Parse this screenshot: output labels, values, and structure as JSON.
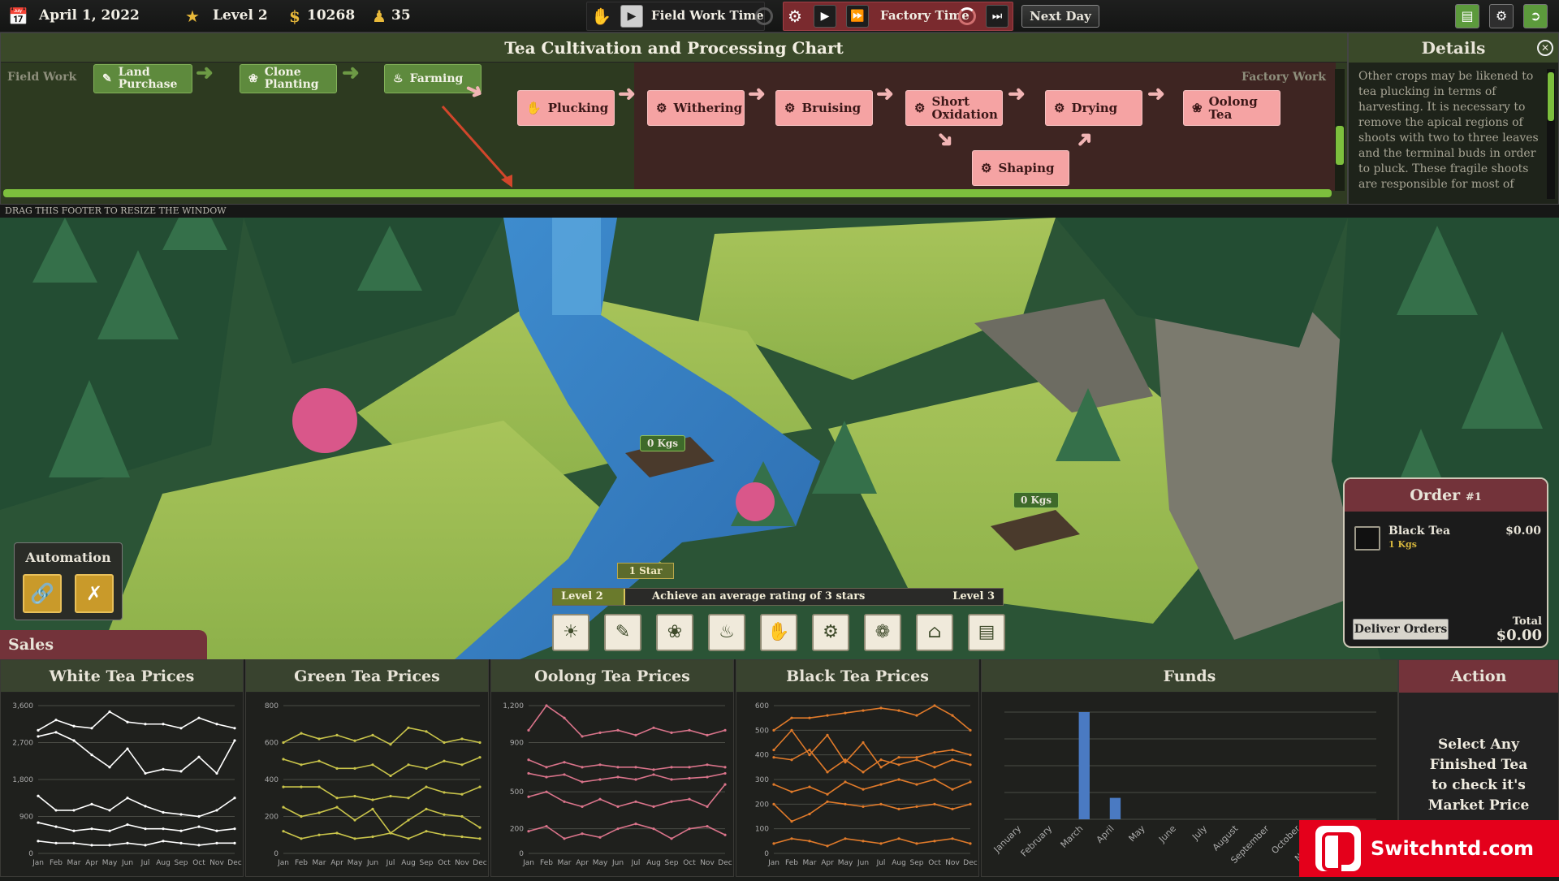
{
  "topbar": {
    "date": "April 1, 2022",
    "level": "Level 2",
    "money": "10268",
    "workers": "35",
    "field_work_time": "Field Work Time",
    "factory_time": "Factory Time",
    "next_day": "Next Day"
  },
  "cultivation_chart": {
    "title": "Tea Cultivation and Processing Chart",
    "field_label": "Field Work",
    "factory_label": "Factory Work",
    "field_nodes": [
      "Land Purchase",
      "Clone Planting",
      "Farming"
    ],
    "factory_nodes": [
      "Plucking",
      "Withering",
      "Bruising",
      "Short Oxidation",
      "Drying",
      "Oolong Tea",
      "Shaping"
    ]
  },
  "details": {
    "title": "Details",
    "text": "Other crops may be likened to tea plucking in terms of harvesting. It is necessary to remove the apical regions of shoots with two to three leaves and the terminal buds in order to pluck. These fragile shoots are responsible for most of"
  },
  "footer_hint": "DRAG THIS FOOTER TO RESIZE THE WINDOW",
  "scene": {
    "plot1_label": "0 Kgs",
    "plot2_label": "0 Kgs"
  },
  "automation": {
    "title": "Automation",
    "icons": [
      "link-icon",
      "unlink-icon"
    ]
  },
  "progress": {
    "star_label": "1 Star",
    "current_level": "Level 2",
    "goal": "Achieve an average rating of 3 stars",
    "next_level": "Level 3",
    "fraction": 0.16
  },
  "toolbar_icons": [
    "weather-icon",
    "pen-icon",
    "plant-icon",
    "watering-can-icon",
    "plucking-icon",
    "gear-icon",
    "leaf-icon",
    "house-icon",
    "chart-icon"
  ],
  "order": {
    "title": "Order",
    "number": "#1",
    "item_name": "Black Tea",
    "item_qty": "1 Kgs",
    "item_price": "$0.00",
    "deliver_label": "Deliver Orders",
    "total_label": "Total",
    "total_value": "$0.00"
  },
  "sales": {
    "tab_label": "Sales",
    "action_title": "Action",
    "action_text": "Select Any Finished Tea to check it's Market Price",
    "funds_title": "Funds"
  },
  "chart_data": [
    {
      "type": "line",
      "title": "White Tea Prices",
      "categories": [
        "Jan",
        "Feb",
        "Mar",
        "Apr",
        "May",
        "Jun",
        "Jul",
        "Aug",
        "Sep",
        "Oct",
        "Nov",
        "Dec"
      ],
      "ylim": [
        0,
        3600
      ],
      "y_ticks": [
        "0",
        "900",
        "1,800",
        "2,700",
        "3,600"
      ],
      "line_color": "#ffffff",
      "series": [
        {
          "values": [
            3000,
            3250,
            3100,
            3050,
            3450,
            3200,
            3150,
            3150,
            3050,
            3300,
            3150,
            3050
          ]
        },
        {
          "values": [
            2850,
            2950,
            2750,
            2400,
            2100,
            2550,
            1950,
            2050,
            2000,
            2350,
            1950,
            2750
          ]
        },
        {
          "values": [
            1400,
            1050,
            1050,
            1200,
            1050,
            1350,
            1150,
            1000,
            950,
            900,
            1050,
            1350
          ]
        },
        {
          "values": [
            750,
            650,
            550,
            600,
            550,
            700,
            600,
            600,
            550,
            650,
            550,
            600
          ]
        },
        {
          "values": [
            300,
            250,
            250,
            200,
            200,
            250,
            200,
            300,
            250,
            200,
            250,
            250
          ]
        }
      ]
    },
    {
      "type": "line",
      "title": "Green Tea Prices",
      "categories": [
        "Jan",
        "Feb",
        "Mar",
        "Apr",
        "May",
        "Jun",
        "Jul",
        "Aug",
        "Sep",
        "Oct",
        "Nov",
        "Dec"
      ],
      "ylim": [
        0,
        800
      ],
      "y_ticks": [
        "0",
        "200",
        "400",
        "600",
        "800"
      ],
      "line_color": "#c9c44a",
      "series": [
        {
          "values": [
            600,
            650,
            620,
            640,
            610,
            640,
            590,
            680,
            660,
            600,
            620,
            600
          ]
        },
        {
          "values": [
            510,
            480,
            500,
            460,
            460,
            480,
            420,
            480,
            460,
            500,
            480,
            520
          ]
        },
        {
          "values": [
            360,
            360,
            360,
            300,
            310,
            290,
            310,
            300,
            360,
            330,
            320,
            360
          ]
        },
        {
          "values": [
            250,
            200,
            220,
            250,
            180,
            240,
            110,
            180,
            240,
            210,
            200,
            140
          ]
        },
        {
          "values": [
            120,
            80,
            100,
            110,
            80,
            90,
            110,
            80,
            120,
            100,
            90,
            80
          ]
        }
      ]
    },
    {
      "type": "line",
      "title": "Oolong Tea Prices",
      "categories": [
        "Jan",
        "Feb",
        "Mar",
        "Apr",
        "May",
        "Jun",
        "Jul",
        "Aug",
        "Sep",
        "Oct",
        "Nov",
        "Dec"
      ],
      "ylim": [
        0,
        1200
      ],
      "y_ticks": [
        "0",
        "200",
        "500",
        "900",
        "1,200"
      ],
      "line_color": "#d9738a",
      "series": [
        {
          "values": [
            1000,
            1200,
            1100,
            950,
            980,
            1000,
            960,
            1020,
            980,
            1000,
            960,
            1000
          ]
        },
        {
          "values": [
            760,
            700,
            740,
            700,
            720,
            700,
            700,
            680,
            700,
            700,
            720,
            700
          ]
        },
        {
          "values": [
            650,
            620,
            640,
            580,
            600,
            620,
            600,
            640,
            600,
            610,
            620,
            650
          ]
        },
        {
          "values": [
            460,
            500,
            420,
            380,
            440,
            380,
            420,
            380,
            420,
            440,
            380,
            560
          ]
        },
        {
          "values": [
            180,
            220,
            120,
            160,
            130,
            200,
            240,
            200,
            120,
            200,
            220,
            150
          ]
        }
      ]
    },
    {
      "type": "line",
      "title": "Black Tea Prices",
      "categories": [
        "Jan",
        "Feb",
        "Mar",
        "Apr",
        "May",
        "Jun",
        "Jul",
        "Aug",
        "Sep",
        "Oct",
        "Nov",
        "Dec"
      ],
      "ylim": [
        0,
        600
      ],
      "y_ticks": [
        "0",
        "100",
        "200",
        "300",
        "400",
        "500",
        "600"
      ],
      "line_color": "#e07a2a",
      "series": [
        {
          "values": [
            500,
            550,
            550,
            560,
            570,
            580,
            590,
            580,
            560,
            600,
            560,
            500
          ]
        },
        {
          "values": [
            420,
            500,
            400,
            480,
            370,
            450,
            350,
            390,
            390,
            410,
            420,
            400
          ]
        },
        {
          "values": [
            390,
            380,
            420,
            330,
            380,
            330,
            380,
            360,
            380,
            350,
            380,
            360
          ]
        },
        {
          "values": [
            280,
            250,
            270,
            240,
            290,
            260,
            280,
            300,
            280,
            300,
            260,
            290
          ]
        },
        {
          "values": [
            200,
            130,
            160,
            210,
            200,
            190,
            200,
            180,
            190,
            200,
            180,
            200
          ]
        },
        {
          "values": [
            40,
            60,
            50,
            30,
            60,
            50,
            40,
            60,
            40,
            50,
            60,
            40
          ]
        }
      ]
    },
    {
      "type": "bar",
      "title": "Funds",
      "categories": [
        "January",
        "February",
        "March",
        "April",
        "May",
        "June",
        "July",
        "August",
        "September",
        "October",
        "November",
        "December"
      ],
      "values": [
        0,
        0,
        100,
        20,
        0,
        0,
        0,
        0,
        0,
        0,
        0,
        0
      ],
      "ylim": [
        0,
        100
      ],
      "bar_color": "#4a7ac2"
    }
  ]
}
